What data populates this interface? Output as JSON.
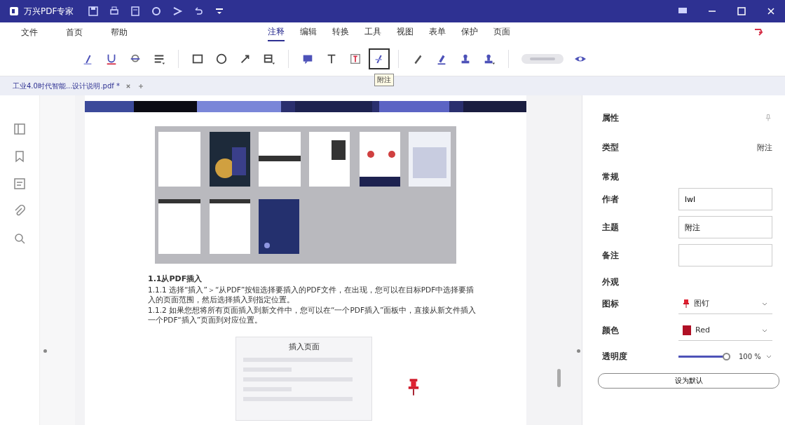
{
  "window": {
    "title": "万兴PDF专家"
  },
  "menu": [
    {
      "label": "文件"
    },
    {
      "label": "首页"
    },
    {
      "label": "帮助"
    }
  ],
  "tabs": [
    {
      "label": "注释",
      "selected": true
    },
    {
      "label": "编辑",
      "selected": false
    },
    {
      "label": "转换",
      "selected": false
    },
    {
      "label": "工具",
      "selected": false
    },
    {
      "label": "视图",
      "selected": false
    },
    {
      "label": "表单",
      "selected": false
    },
    {
      "label": "保护",
      "selected": false
    },
    {
      "label": "页面",
      "selected": false
    }
  ],
  "toolbar": [
    {
      "kind": "highlight",
      "selected": false
    },
    {
      "kind": "underline",
      "selected": false
    },
    {
      "kind": "strike",
      "selected": false
    },
    {
      "kind": "lines",
      "selected": false
    },
    {
      "kind": "sep",
      "selected": false
    },
    {
      "kind": "rect",
      "selected": false
    },
    {
      "kind": "circle",
      "selected": false
    },
    {
      "kind": "arrow",
      "selected": false
    },
    {
      "kind": "area",
      "selected": false
    },
    {
      "kind": "sep",
      "selected": false
    },
    {
      "kind": "comment",
      "selected": false
    },
    {
      "kind": "text",
      "selected": false
    },
    {
      "kind": "textbox",
      "selected": false
    },
    {
      "kind": "note",
      "selected": true
    },
    {
      "kind": "sep",
      "selected": false
    },
    {
      "kind": "pencil",
      "selected": false
    },
    {
      "kind": "eraser",
      "selected": false
    },
    {
      "kind": "stamp",
      "selected": false
    },
    {
      "kind": "stamp2",
      "selected": false
    }
  ],
  "tooltip": "附注",
  "annotations_toggle": {
    "on": false
  },
  "doc_tab": {
    "label": "工业4.0时代智能...设计说明.pdf *"
  },
  "document": {
    "heading": "1.1从PDF插入",
    "paragraphs": [
      "1.1.1 选择“插入”＞“从PDF”按钮选择要插入的PDF文件，在出现，您可以在目标PDF中选择要插入的页面范围，然后选择插入到指定位置。",
      "1.1.2 如果您想将所有页面插入到新文件中，您可以在“一个PDF插入”面板中，直接从新文件插入一个PDF“插入”页面到对应位置。"
    ],
    "dialog_title": "插入页面"
  },
  "panel": {
    "title": "属性",
    "type_label": "类型",
    "type_value": "附注",
    "general": "常规",
    "fields": [
      {
        "label": "作者",
        "value": "lwl"
      },
      {
        "label": "主题",
        "value": "附注"
      },
      {
        "label": "备注"
      }
    ],
    "appearance": "外观",
    "icon_label": "图标",
    "icon_value": "图钉",
    "color_label": "颜色",
    "color_value": "Red",
    "color": "#b01025",
    "opacity_label": "透明度",
    "opacity": {
      "level": 1.0,
      "reading": "100 %"
    },
    "default_button": "设为默认"
  }
}
